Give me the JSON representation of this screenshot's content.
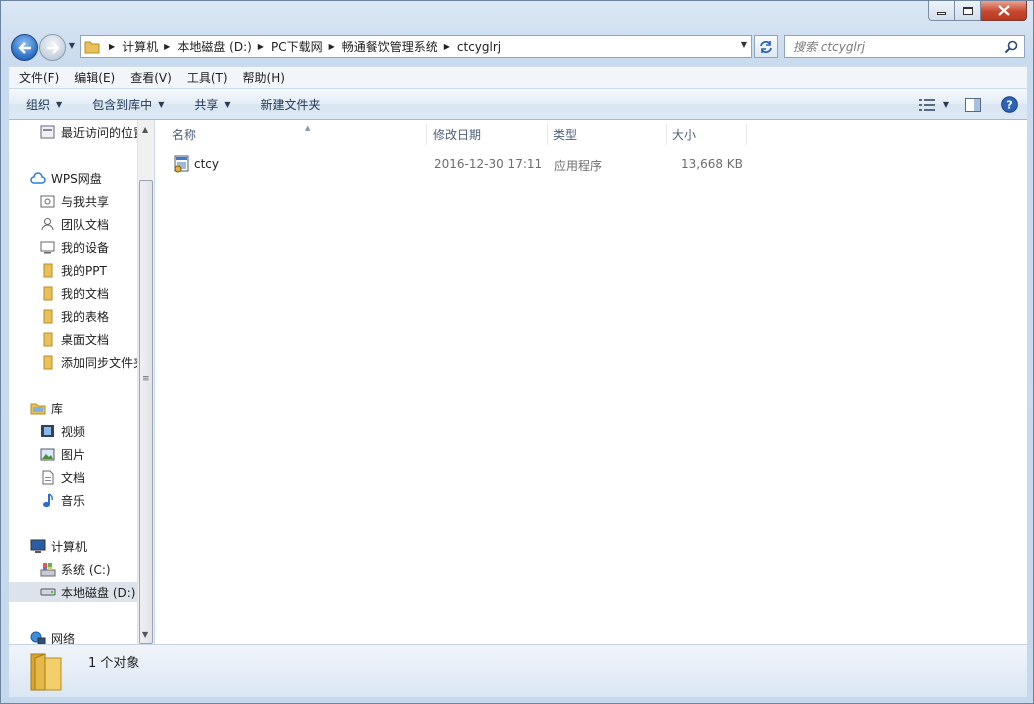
{
  "window": {
    "caption": {
      "minimize": "minimize",
      "maximize": "maximize",
      "close": "close"
    }
  },
  "address": {
    "crumbs": [
      "计算机",
      "本地磁盘 (D:)",
      "PC下载网",
      "畅通餐饮管理系统",
      "ctcyglrj"
    ]
  },
  "search": {
    "placeholder": "搜索 ctcyglrj"
  },
  "menubar": {
    "items": [
      "文件(F)",
      "编辑(E)",
      "查看(V)",
      "工具(T)",
      "帮助(H)"
    ]
  },
  "commandbar": {
    "organize": "组织",
    "include_in_library": "包含到库中",
    "share": "共享",
    "new_folder": "新建文件夹"
  },
  "navpane": {
    "recent": "最近访问的位置",
    "wps": "WPS网盘",
    "wps_items": [
      "与我共享",
      "团队文档",
      "我的设备",
      "我的PPT",
      "我的文档",
      "我的表格",
      "桌面文档",
      "添加同步文件夹"
    ],
    "libraries": "库",
    "library_items": [
      "视频",
      "图片",
      "文档",
      "音乐"
    ],
    "computer": "计算机",
    "drives": [
      "系统 (C:)",
      "本地磁盘 (D:)"
    ],
    "network": "网络"
  },
  "columns": {
    "name": "名称",
    "modified": "修改日期",
    "type": "类型",
    "size": "大小"
  },
  "files": [
    {
      "name": "ctcy",
      "modified": "2016-12-30 17:11",
      "type": "应用程序",
      "size": "13,668 KB"
    }
  ],
  "status": {
    "count": "1 个对象"
  },
  "colors": {
    "selection": "#dde3ea",
    "accent": "#2b6cc2",
    "header_text": "#4c607a"
  }
}
